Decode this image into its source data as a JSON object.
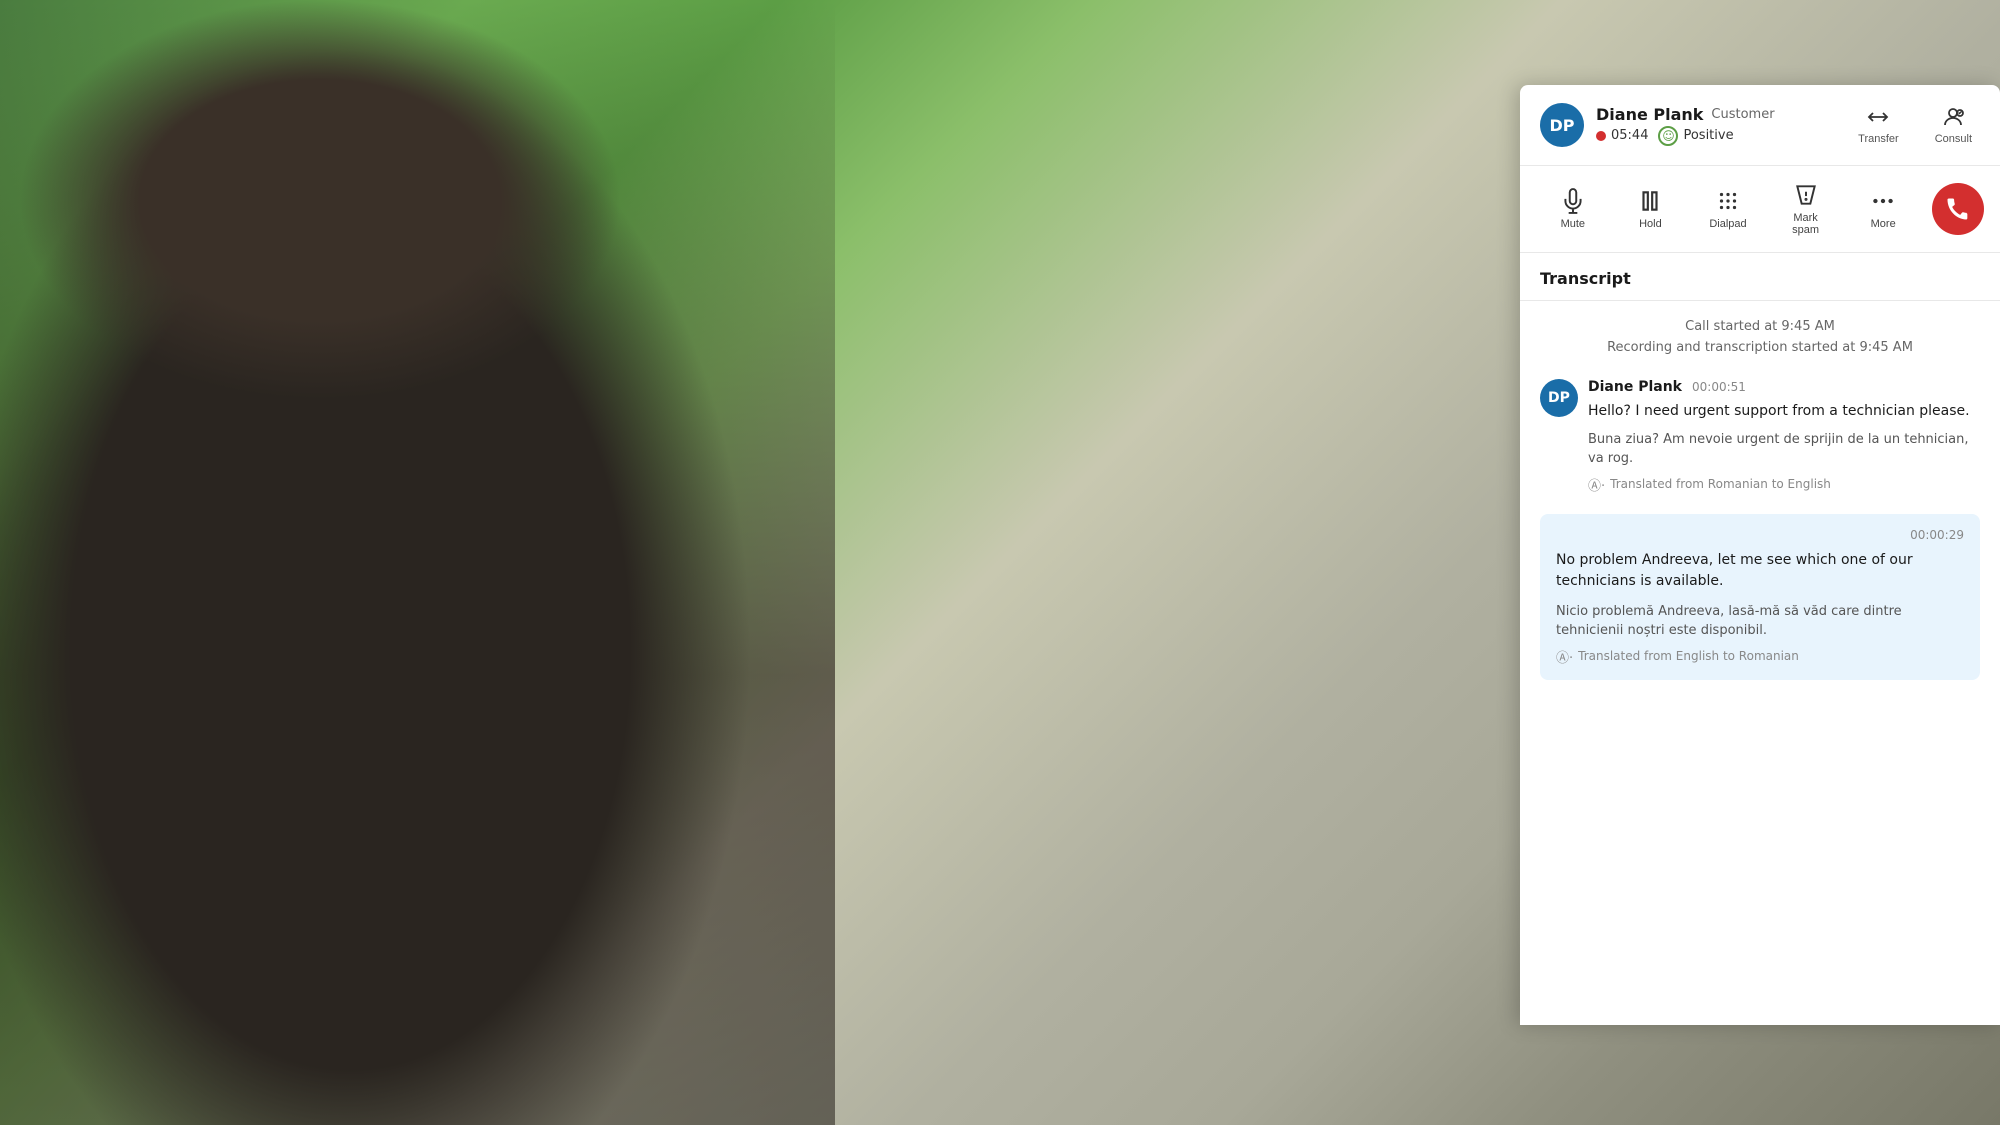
{
  "background": {
    "description": "outdoor scene with person on phone"
  },
  "panel": {
    "header": {
      "avatar_initials": "DP",
      "caller_name": "Diane Plank",
      "caller_role": "Customer",
      "call_timer": "05:44",
      "sentiment_label": "Positive",
      "transfer_label": "Transfer",
      "consult_label": "Consult"
    },
    "toolbar": {
      "mute_label": "Mute",
      "hold_label": "Hold",
      "dialpad_label": "Dialpad",
      "mark_spam_label": "Mark spam",
      "more_label": "More",
      "end_call_label": "End call"
    },
    "transcript": {
      "title": "Transcript",
      "call_started": "Call started at 9:45 AM",
      "recording_started": "Recording and transcription started at 9:45 AM",
      "messages": [
        {
          "type": "customer",
          "sender": "Diane Plank",
          "timestamp": "00:00:51",
          "text": "Hello? I need urgent support from a technician please.",
          "translated_text": "Buna ziua? Am nevoie urgent de sprijin de la un tehnician, va rog.",
          "translation_note": "Translated from Romanian to English"
        },
        {
          "type": "agent",
          "timestamp": "00:00:29",
          "text": "No problem Andreeva, let me see which one of our technicians is available.",
          "translated_text": "Nicio problemă Andreeva, lasă-mă să văd care dintre tehnicienii noștri este disponibil.",
          "translation_note": "Translated from English to Romanian"
        }
      ]
    }
  }
}
